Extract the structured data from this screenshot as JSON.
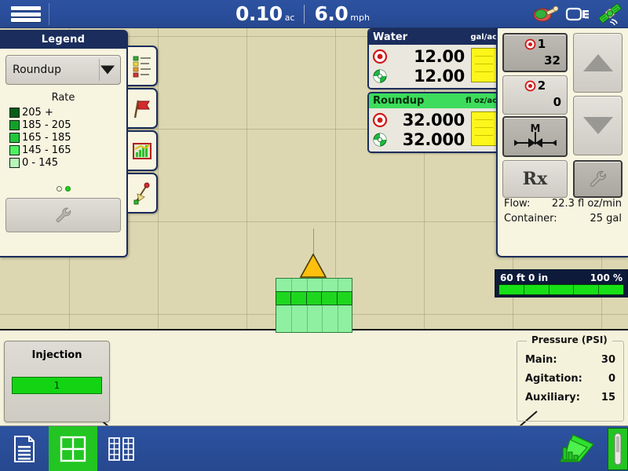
{
  "topbar": {
    "menu_icon": "hamburger-menu-icon",
    "area_value": "0.10",
    "area_unit": "ac",
    "speed_value": "6.0",
    "speed_unit": "mph",
    "icons": [
      "sprayer-nozzle-icon",
      "display-connection-icon",
      "gps-satellite-icon"
    ]
  },
  "legend": {
    "title": "Legend",
    "selected_product": "Roundup",
    "dropdown_icon": "chevron-down-icon",
    "rate_label": "Rate",
    "items": [
      {
        "label": "205 +",
        "color": "#0a5d14"
      },
      {
        "label": "185 - 205",
        "color": "#14a028"
      },
      {
        "label": "165 - 185",
        "color": "#21c63a"
      },
      {
        "label": "145 - 165",
        "color": "#4ef060"
      },
      {
        "label": "0 - 145",
        "color": "#b7f5b7"
      }
    ],
    "page_dots": [
      "off",
      "on"
    ],
    "settings_icon": "wrench-icon"
  },
  "tooltabs": [
    {
      "name": "legend-ranges-icon"
    },
    {
      "name": "flag-marker-icon"
    },
    {
      "name": "chart-coverage-icon"
    },
    {
      "name": "compass-pointer-icon"
    }
  ],
  "products": [
    {
      "name": "Water",
      "unit": "gal/ac",
      "header_style": "water",
      "target_icon": "target-rate-icon",
      "actual_icon": "actual-rate-icon",
      "target_value": "12.00",
      "actual_value": "12.00"
    },
    {
      "name": "Roundup",
      "unit": "fl oz/ac",
      "header_style": "roundup",
      "target_icon": "target-rate-icon",
      "actual_icon": "actual-rate-icon",
      "target_value": "32.000",
      "actual_value": "32.000"
    }
  ],
  "control_panel": {
    "channels": [
      {
        "label": "1",
        "value": "32",
        "selected": true,
        "icon": "target-rate-icon"
      },
      {
        "label": "2",
        "value": "0",
        "selected": false,
        "icon": "target-rate-icon"
      }
    ],
    "increase_icon": "triangle-up-icon",
    "decrease_icon": "triangle-down-icon",
    "valve_icon": "manual-valve-icon",
    "valve_label": "M",
    "prescription_label": "Rx",
    "settings_icon": "wrench-icon",
    "stats": [
      {
        "label": "Flow:",
        "value": "22.3 fl oz/min"
      },
      {
        "label": "Container:",
        "value": "25 gal"
      }
    ]
  },
  "width_bar": {
    "width_label": "60 ft 0 in",
    "percent_label": "100 %",
    "segments": 5
  },
  "injection": {
    "title": "Injection",
    "bar_label": "1"
  },
  "pressure": {
    "title": "Pressure (PSI)",
    "rows": [
      {
        "label": "Main:",
        "value": "30"
      },
      {
        "label": "Agitation:",
        "value": "0"
      },
      {
        "label": "Auxiliary:",
        "value": "15"
      }
    ]
  },
  "taskbar": {
    "items": [
      {
        "name": "document-page-icon",
        "active": false
      },
      {
        "name": "map-grid-view-icon",
        "active": true
      },
      {
        "name": "data-table-view-icon",
        "active": false
      }
    ],
    "right_icon": "coverage-map-icon",
    "scroll_icon": "scroll-handle-icon"
  },
  "map": {
    "vehicle_icon": "vehicle-triangle-icon",
    "boom_sections": 5,
    "coverage_color": "#8ef0a0",
    "boom_color": "#1fd61f",
    "field_color": "#dcd7b0"
  }
}
